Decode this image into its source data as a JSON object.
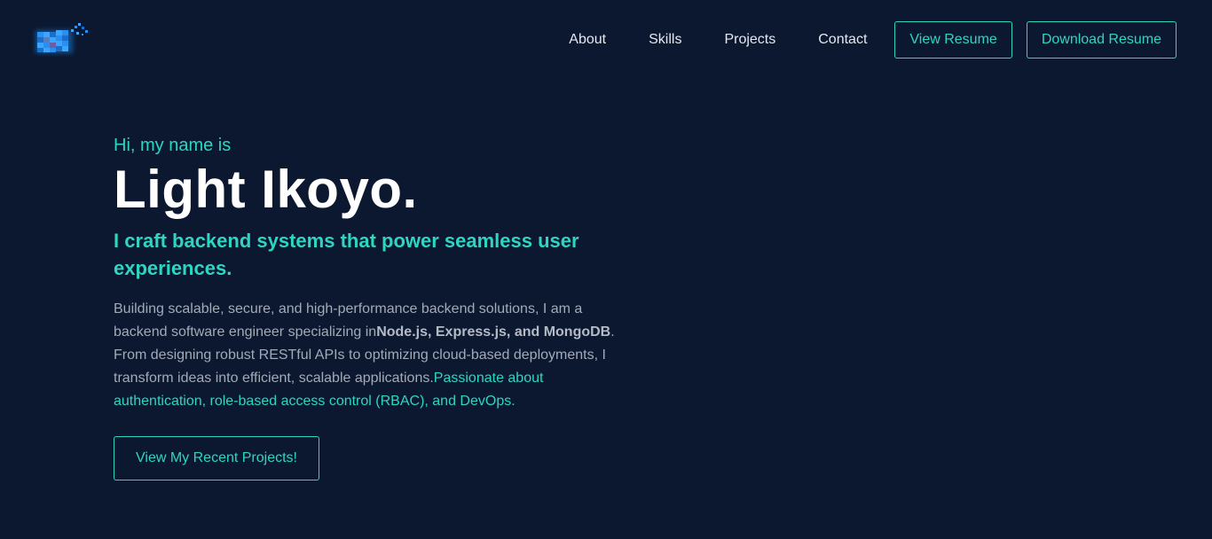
{
  "nav": {
    "links": [
      "About",
      "Skills",
      "Projects",
      "Contact"
    ],
    "view_resume": "View Resume",
    "download_resume": "Download Resume"
  },
  "hero": {
    "greeting": "Hi, my name is",
    "name": "Light Ikoyo.",
    "tagline": "I craft backend systems that power seamless user experiences.",
    "bio_part1": "Building scalable, secure, and high-performance backend solutions, I am a backend software engineer specializing in",
    "bio_bold": "Node.js, Express.js, and MongoDB",
    "bio_part2": ". From designing robust RESTful APIs to optimizing cloud-based deployments, I transform ideas into efficient, scalable applications.",
    "bio_accent": "Passionate about authentication, role-based access control (RBAC), and DevOps.",
    "cta": "View My Recent Projects!"
  },
  "colors": {
    "background": "#0b1830",
    "accent": "#2ed6c1",
    "text": "#e4e8f0",
    "muted": "#a3aab8"
  },
  "icons": {
    "logo": "pixel-logo-icon"
  }
}
